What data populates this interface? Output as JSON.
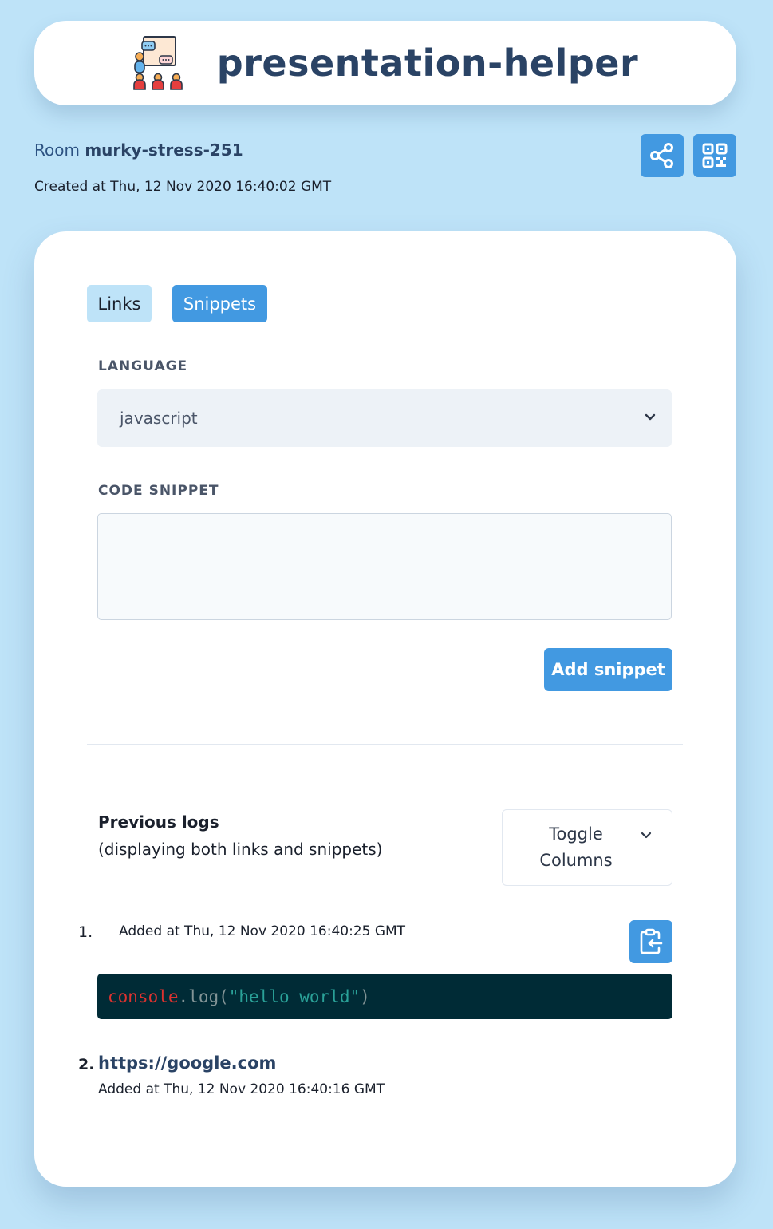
{
  "header": {
    "app_title": "presentation-helper"
  },
  "room": {
    "prefix": "Room",
    "name": "murky-stress-251",
    "created": "Created at Thu, 12 Nov 2020 16:40:02 GMT"
  },
  "tabs": {
    "links_label": "Links",
    "snippets_label": "Snippets",
    "active": "Snippets"
  },
  "form": {
    "language_label": "LANGUAGE",
    "language_value": "javascript",
    "code_label": "CODE SNIPPET",
    "code_value": "",
    "submit_label": "Add snippet"
  },
  "logs": {
    "title": "Previous logs",
    "subtitle": "(displaying both links and snippets)",
    "toggle_label": "Toggle Columns",
    "entries": [
      {
        "number": "1.",
        "added": "Added at Thu, 12 Nov 2020 16:40:25 GMT",
        "code": {
          "object": "console",
          "dot": ".",
          "method": "log(",
          "string": "\"hello world\"",
          "close": ")"
        }
      },
      {
        "number": "2.",
        "link": "https://google.com",
        "added": "Added at Thu, 12 Nov 2020 16:40:16 GMT"
      }
    ]
  },
  "colors": {
    "page_background": "#bee3f8",
    "accent": "#4299e1",
    "title_text": "#2a4365",
    "code_background": "#002b36"
  },
  "icons": {
    "logo": "presentation-people-icon",
    "share": "share-icon",
    "qr": "qr-code-icon",
    "select": "chevron-down-icon",
    "copy": "clipboard-copy-icon"
  }
}
